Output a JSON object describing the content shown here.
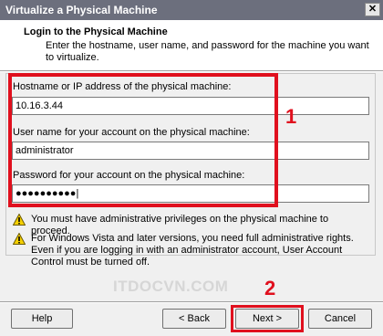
{
  "window": {
    "title": "Virtualize a Physical Machine",
    "close_glyph": "✕"
  },
  "header": {
    "title": "Login to the Physical Machine",
    "description": "Enter the hostname, user name, and password for the machine you want to virtualize."
  },
  "form": {
    "hostname_label": "Hostname or IP address of the physical machine:",
    "hostname_value": "10.16.3.44",
    "username_label": "User name for your account on the physical machine:",
    "username_value": "administrator",
    "password_label": "Password for your account on the physical machine:",
    "password_value": "●●●●●●●●●●|"
  },
  "warnings": [
    {
      "icon": "warning-icon",
      "text": "You must have administrative privileges on the physical machine to proceed."
    },
    {
      "icon": "warning-icon",
      "text": "For Windows Vista and later versions, you need full administrative rights. Even if you are logging in with an administrator account, User Account Control must be turned off."
    }
  ],
  "annotations": {
    "marker_1": "1",
    "marker_2": "2",
    "highlight_color": "#e0101e"
  },
  "watermark": "ITDOCVN.COM",
  "buttons": {
    "help": "Help",
    "back": "< Back",
    "next": "Next >",
    "cancel": "Cancel"
  }
}
